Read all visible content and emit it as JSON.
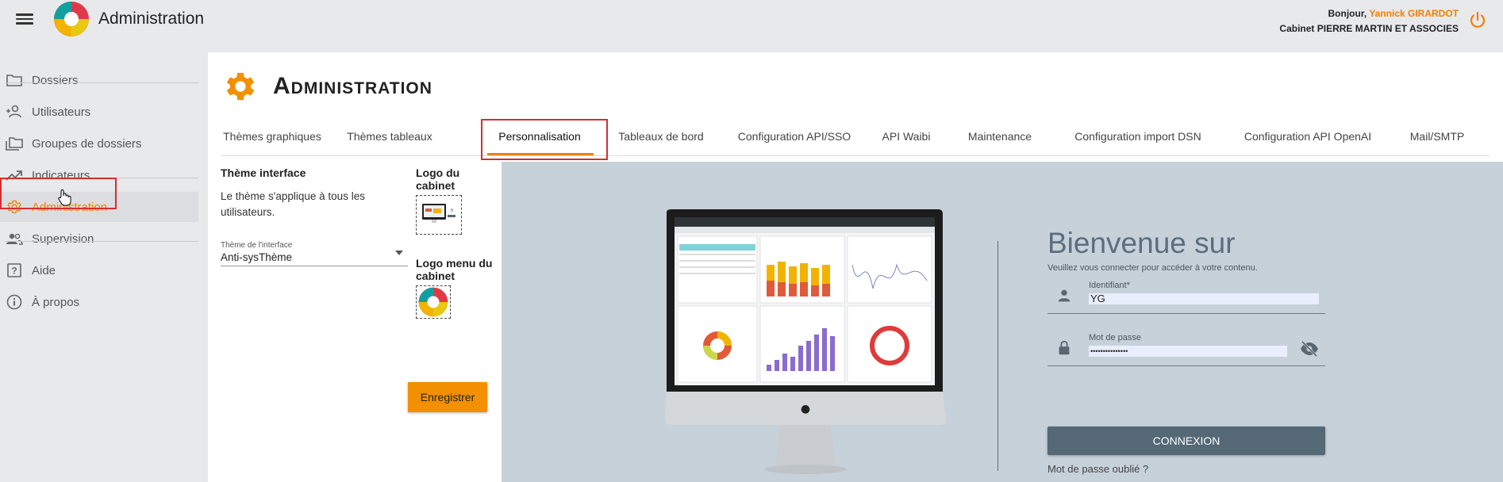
{
  "app": {
    "title": "Administration"
  },
  "header": {
    "greeting_prefix": "Bonjour,",
    "user_name": "Yannick GIRARDOT",
    "cabinet": "Cabinet PIERRE MARTIN ET ASSOCIES"
  },
  "sidebar": {
    "items": [
      {
        "label": "Dossiers",
        "icon": "folder-icon"
      },
      {
        "label": "Utilisateurs",
        "icon": "add-user-icon"
      },
      {
        "label": "Groupes de dossiers",
        "icon": "folders-icon"
      },
      {
        "label": "Indicateurs",
        "icon": "trending-up-icon"
      },
      {
        "label": "Administration",
        "icon": "gear-icon",
        "active": true
      },
      {
        "label": "Supervision",
        "icon": "people-icon"
      },
      {
        "label": "Aide",
        "icon": "help-icon"
      },
      {
        "label": "À propos",
        "icon": "info-icon"
      }
    ]
  },
  "page": {
    "title": "Administration"
  },
  "tabs": [
    "Thèmes graphiques",
    "Thèmes tableaux",
    "Personnalisation",
    "Tableaux de bord",
    "Configuration API/SSO",
    "API Waibi",
    "Maintenance",
    "Configuration import DSN",
    "Configuration API OpenAI",
    "Mail/SMTP"
  ],
  "active_tab": "Personnalisation",
  "theme": {
    "heading": "Thème interface",
    "description": "Le thème s'applique à tous les utilisateurs.",
    "select_label": "Thème de l'interface",
    "select_value": "Anti-sysThème"
  },
  "logos": {
    "cabinet_label": "Logo du cabinet",
    "menu_label": "Logo menu du cabinet",
    "save_label": "Enregistrer"
  },
  "preview": {
    "welcome": "Bienvenue sur",
    "subtitle": "Veuillez vous connecter pour accéder à votre contenu.",
    "login_label": "Identifiant*",
    "login_value": "YG",
    "password_label": "Mot de passe",
    "password_value": "•••••••••••••••",
    "connect_label": "CONNEXION",
    "forgot_label": "Mot de passe oublié ?"
  },
  "colors": {
    "accent": "#f08000",
    "save_button": "#f29000",
    "connect_button": "#546876",
    "preview_bg": "#c7d1da",
    "highlight_box": "#d32f2f"
  }
}
